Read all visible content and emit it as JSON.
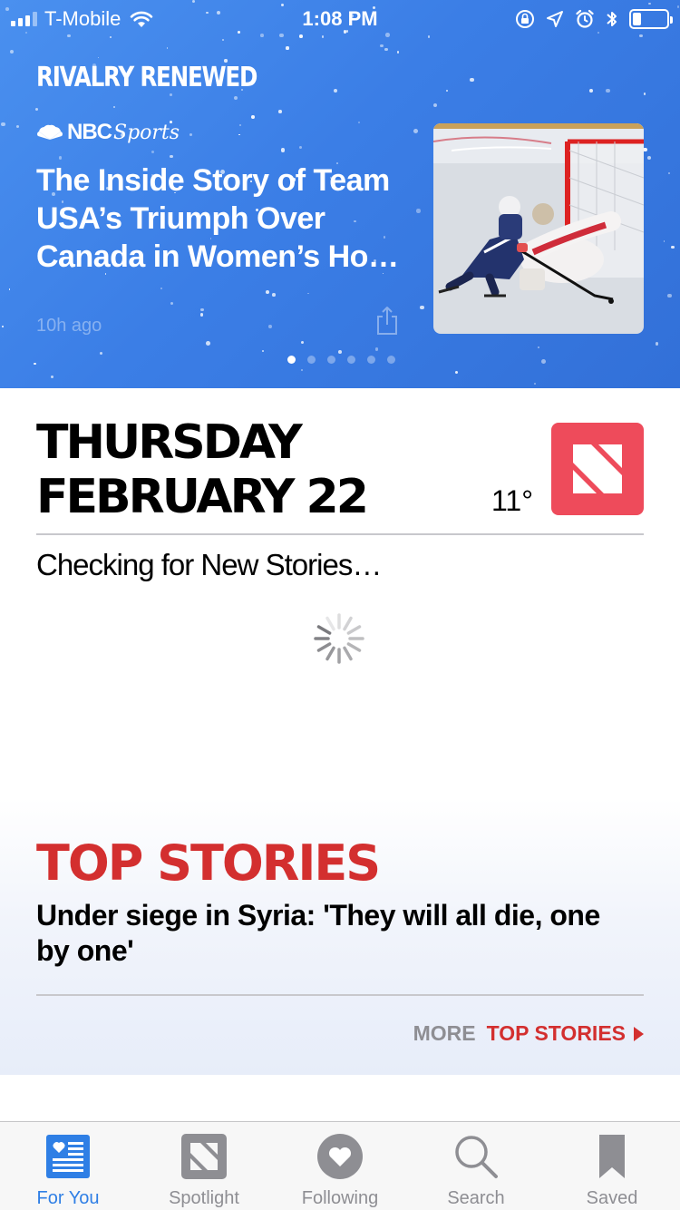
{
  "status_bar": {
    "carrier": "T-Mobile",
    "time": "1:08 PM",
    "signal_bars_filled": 3,
    "signal_bars_total": 4,
    "battery_level": 0.25,
    "icons": [
      "wifi-icon",
      "orientation-lock-icon",
      "location-icon",
      "alarm-icon",
      "bluetooth-icon",
      "battery-icon"
    ]
  },
  "hero": {
    "label": "RIVALRY RENEWED",
    "source_nbc": "NBC",
    "source_sports": "Sports",
    "headline": "The Inside Story of Team USA’s Triumph Over Canada in Women’s Ho…",
    "time": "10h ago",
    "page_count": 6,
    "active_page": 0,
    "image_subject": "women's ice hockey player"
  },
  "date_section": {
    "line1": "THURSDAY",
    "line2": "FEBRUARY 22",
    "temperature": "11°",
    "status": "Checking for New Stories…"
  },
  "top_stories": {
    "title": "TOP STORIES",
    "headline": "Under siege in Syria: 'They will all die, one by one'",
    "more_label": "MORE",
    "more_target": "TOP STORIES"
  },
  "tabs": [
    {
      "label": "For You",
      "icon": "for-you-icon",
      "active": true
    },
    {
      "label": "Spotlight",
      "icon": "spotlight-icon",
      "active": false
    },
    {
      "label": "Following",
      "icon": "following-icon",
      "active": false
    },
    {
      "label": "Search",
      "icon": "search-icon",
      "active": false
    },
    {
      "label": "Saved",
      "icon": "saved-icon",
      "active": false
    }
  ],
  "colors": {
    "hero_blue": "#3b7ee6",
    "accent_red": "#d32f2f",
    "news_logo_red": "#ee4b5b",
    "tab_active_blue": "#2f7fe5",
    "tab_inactive_gray": "#8e8e93"
  }
}
